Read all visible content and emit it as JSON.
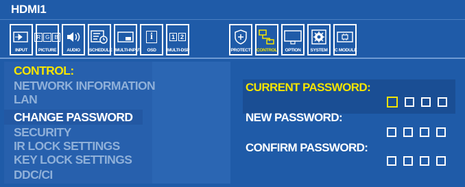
{
  "title": "HDMI1",
  "toolbar": {
    "items": [
      {
        "label": "INPUT",
        "icon": "input-icon"
      },
      {
        "label": "PICTURE",
        "icon": "rgb-picture-icon"
      },
      {
        "label": "AUDIO",
        "icon": "speaker-icon"
      },
      {
        "label": "SCHEDULE",
        "icon": "schedule-icon"
      },
      {
        "label": "MULTI-INPUT",
        "icon": "multi-input-icon"
      },
      {
        "label": "OSD",
        "icon": "info-icon"
      },
      {
        "label": "MULTI-DSP",
        "icon": "multi-display-icon"
      },
      {
        "label": "PROTECT",
        "icon": "shield-plus-icon"
      },
      {
        "label": "CONTROL",
        "icon": "control-network-icon"
      },
      {
        "label": "OPTION",
        "icon": "option-screen-icon"
      },
      {
        "label": "SYSTEM",
        "icon": "gear-icon"
      },
      {
        "label": "C MODULE",
        "icon": "compute-module-icon"
      }
    ],
    "active": "CONTROL",
    "rgb_letters": [
      "R",
      "G",
      "B"
    ],
    "multi_dsp_digits": [
      "1",
      "2"
    ],
    "osd_glyph": "i"
  },
  "menu": {
    "header": "CONTROL:",
    "items": [
      "NETWORK INFORMATION",
      "LAN",
      "CHANGE PASSWORD",
      "SECURITY",
      "IR LOCK SETTINGS",
      "KEY LOCK SETTINGS",
      "DDC/CI"
    ],
    "selected": "CHANGE PASSWORD"
  },
  "password": {
    "current_label": "CURRENT PASSWORD:",
    "new_label": "NEW PASSWORD:",
    "confirm_label": "CONFIRM PASSWORD:",
    "digits_per_field": 4
  },
  "colors": {
    "background": "#1f5ba8",
    "highlight": "#f5e400",
    "dim_text": "#8fb0d9",
    "text": "#ffffff"
  }
}
